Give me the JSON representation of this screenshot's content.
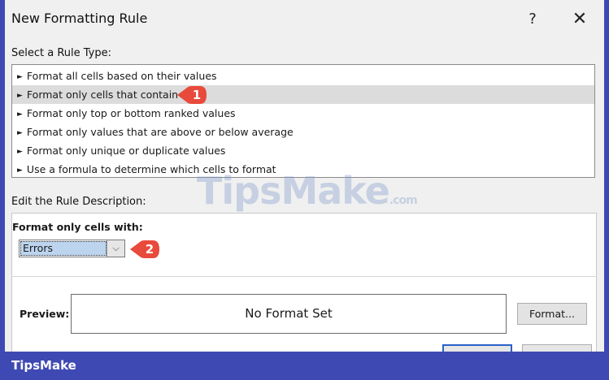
{
  "dialog": {
    "title": "New Formatting Rule",
    "help_icon": "?",
    "close_icon": "✕"
  },
  "rule_type": {
    "label": "Select a Rule Type:",
    "items": [
      {
        "label": "Format all cells based on their values",
        "selected": false
      },
      {
        "label": "Format only cells that contain",
        "selected": true
      },
      {
        "label": "Format only top or bottom ranked values",
        "selected": false
      },
      {
        "label": "Format only values that are above or below average",
        "selected": false
      },
      {
        "label": "Format only unique or duplicate values",
        "selected": false
      },
      {
        "label": "Use a formula to determine which cells to format",
        "selected": false
      }
    ]
  },
  "description": {
    "label": "Edit the Rule Description:",
    "format_only_label": "Format only cells with:",
    "select_value": "Errors",
    "preview_label": "Preview:",
    "preview_text": "No Format Set",
    "format_button": "Format..."
  },
  "callouts": {
    "one": "1",
    "two": "2"
  },
  "icons": {
    "arrow": "►",
    "dropdown": "⌵"
  },
  "watermark": {
    "text": "TipsMake",
    "suffix": ".com"
  },
  "footer": {
    "brand": "TipsMake"
  },
  "colors": {
    "frame": "#3f49b3",
    "callout": "#e84a3b",
    "selection": "#bcd4ee"
  }
}
